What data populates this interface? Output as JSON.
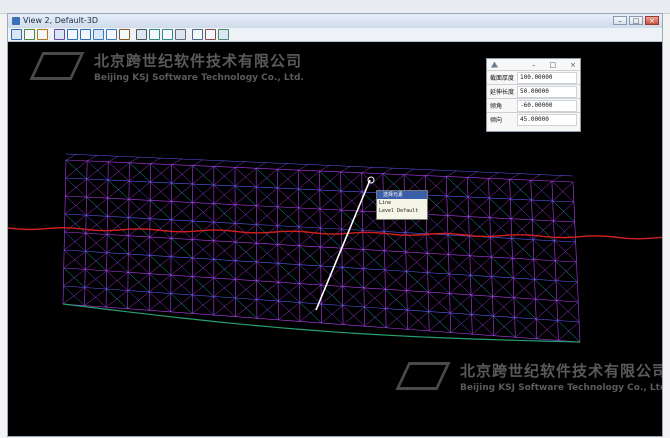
{
  "window": {
    "title": "View 2, Default-3D",
    "buttons": {
      "minimize": "–",
      "maximize": "□",
      "close": "×"
    }
  },
  "toolbar": {
    "icons": [
      "view-attributes-icon",
      "levels-icon",
      "display-style-icon",
      "update-icon",
      "zoom-in-icon",
      "zoom-out-icon",
      "window-area-icon",
      "fit-view-icon",
      "rotate-view-icon",
      "pan-icon",
      "view-previous-icon",
      "view-next-icon",
      "toggle-3d-icon",
      "camera-icon",
      "view-clip-icon",
      "render-icon"
    ]
  },
  "watermark": {
    "cn": "北京跨世纪软件技术有限公司",
    "en": "Beijing KSJ Software Technology Co., Ltd."
  },
  "panel": {
    "close_symbol": "×",
    "rows": [
      {
        "label": "截面厚度",
        "value": "100.00000"
      },
      {
        "label": "延伸长度",
        "value": "50.00000"
      },
      {
        "label": "倾角",
        "value": "-60.00000"
      },
      {
        "label": "倾向",
        "value": "45.00000"
      }
    ]
  },
  "popup": {
    "title": "选择元素",
    "line1": "Line",
    "line2": "Level  Default"
  },
  "colors": {
    "mesh_purple": "#b03cf0",
    "mesh_blue": "#5a5af5",
    "mesh_cyan": "#20b8c8",
    "mesh_green": "#28a070",
    "terrain_red": "#d42020",
    "selection_white": "#ffffff",
    "viewport_bg": "#000000"
  }
}
